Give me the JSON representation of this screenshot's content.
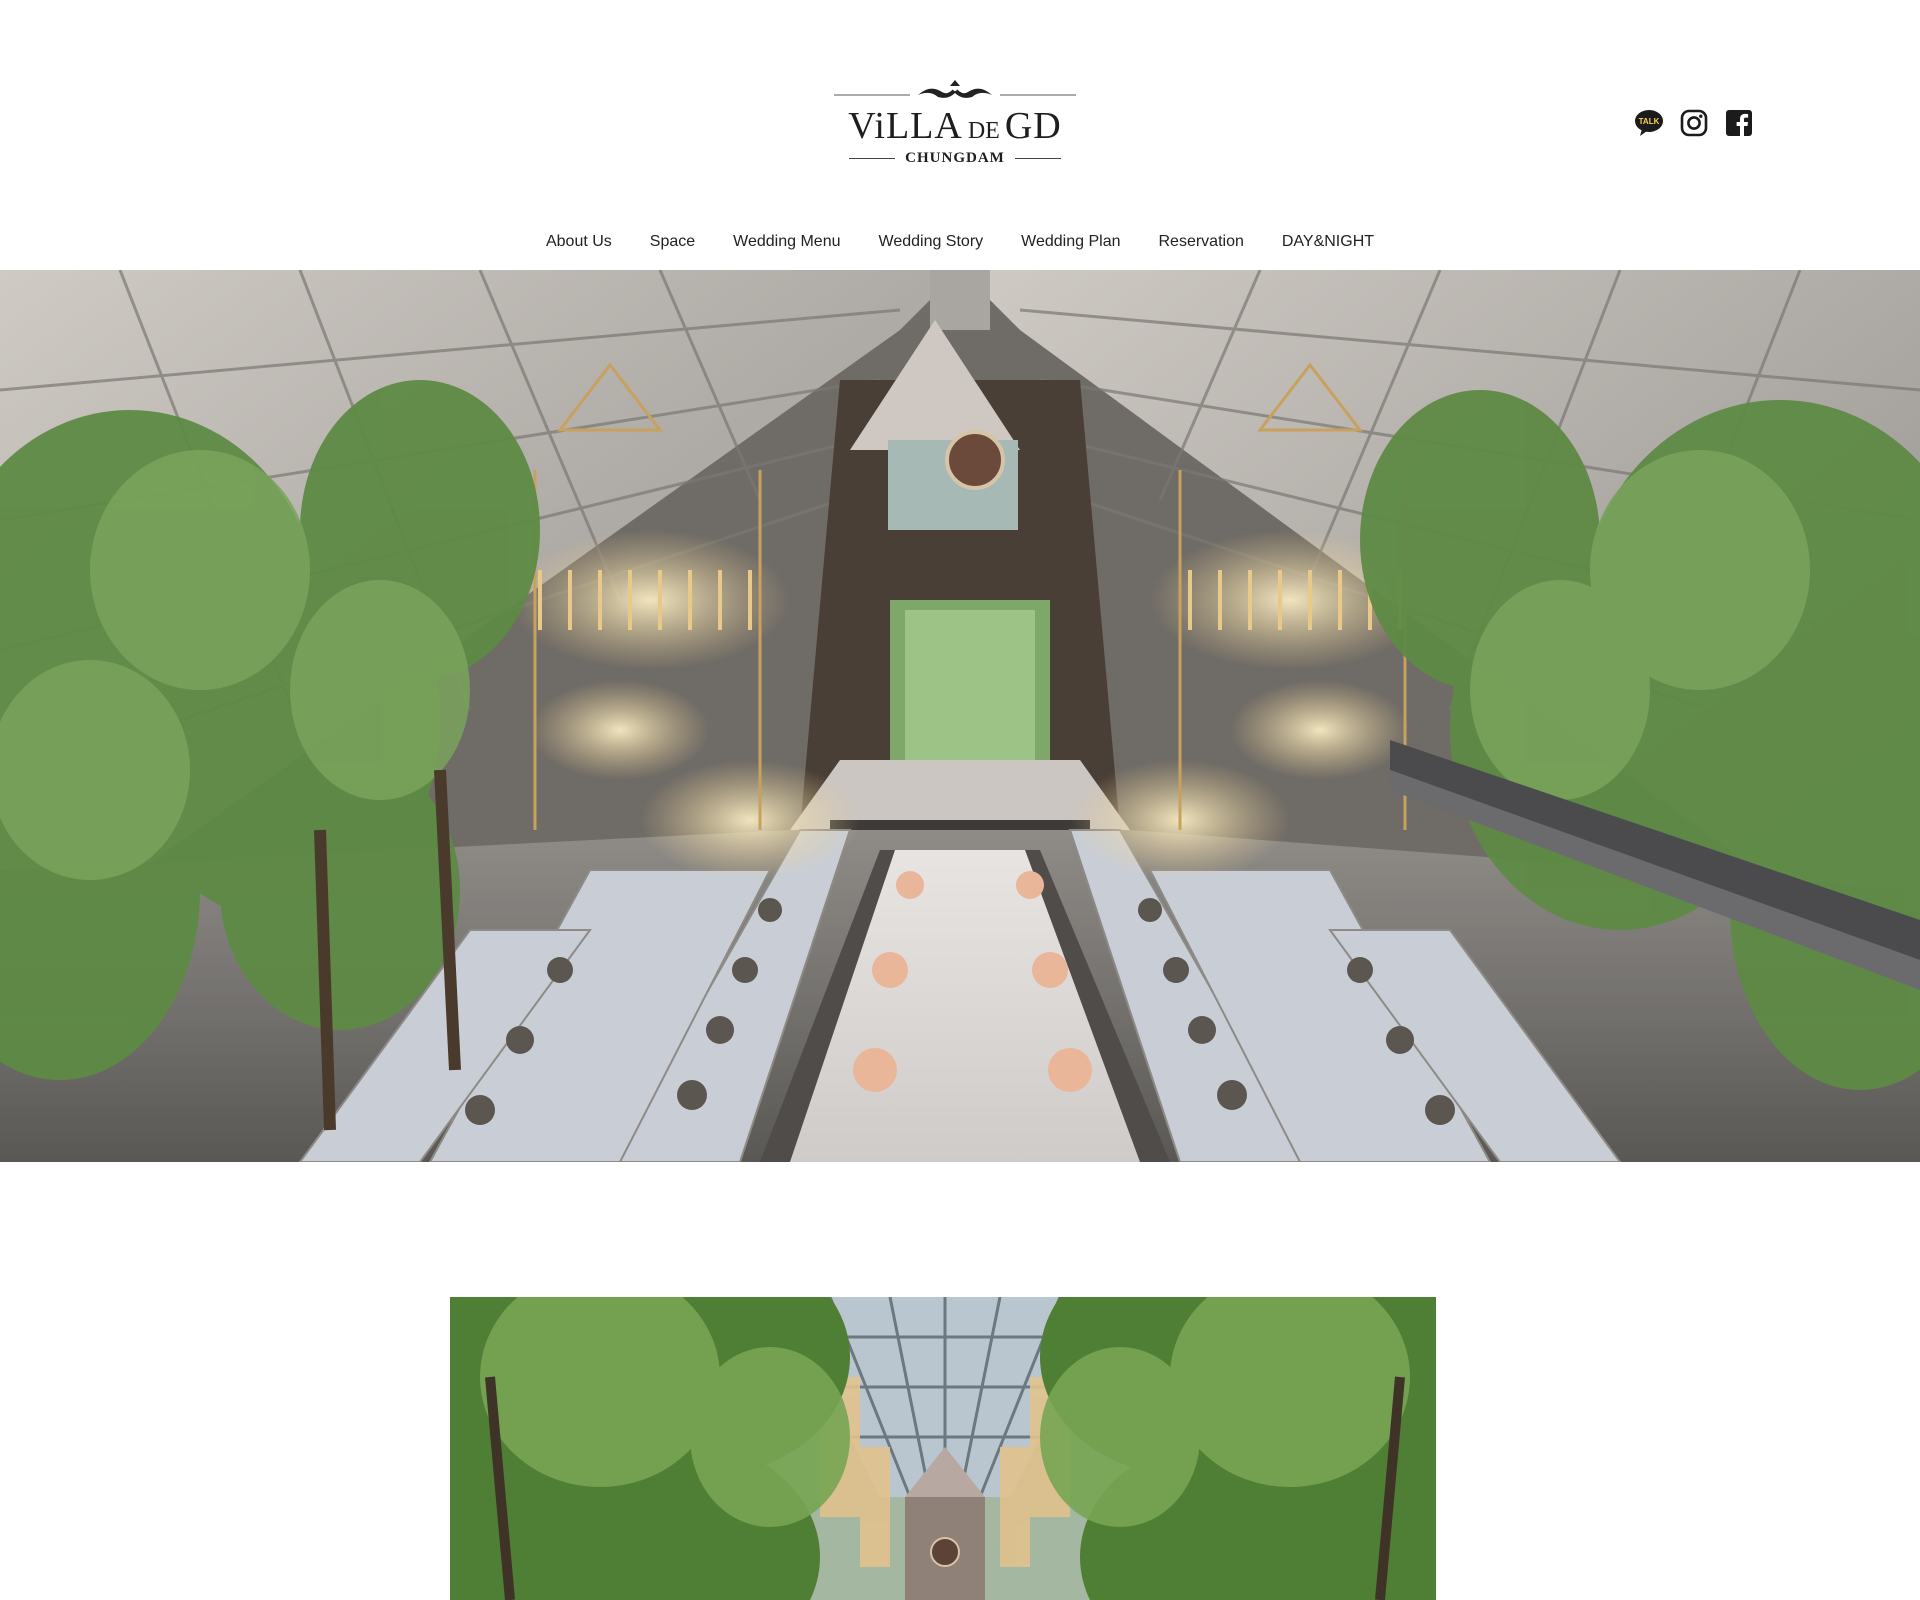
{
  "logo": {
    "main_before": "ViLLA",
    "main_de": "DE",
    "main_after": "GD",
    "sub": "CHUNGDAM"
  },
  "social": [
    "kakaotalk-icon",
    "instagram-icon",
    "facebook-icon"
  ],
  "social_badge": "TALK",
  "nav": {
    "items": [
      {
        "label": "About Us"
      },
      {
        "label": "Space"
      },
      {
        "label": "Wedding Menu"
      },
      {
        "label": "Wedding Story"
      },
      {
        "label": "Wedding Plan"
      },
      {
        "label": "Reservation"
      },
      {
        "label": "DAY&NIGHT"
      }
    ]
  },
  "colors": {
    "text": "#222222",
    "background": "#ffffff",
    "foliage": "#5e8a45",
    "candle_gold": "#e8c98a"
  }
}
